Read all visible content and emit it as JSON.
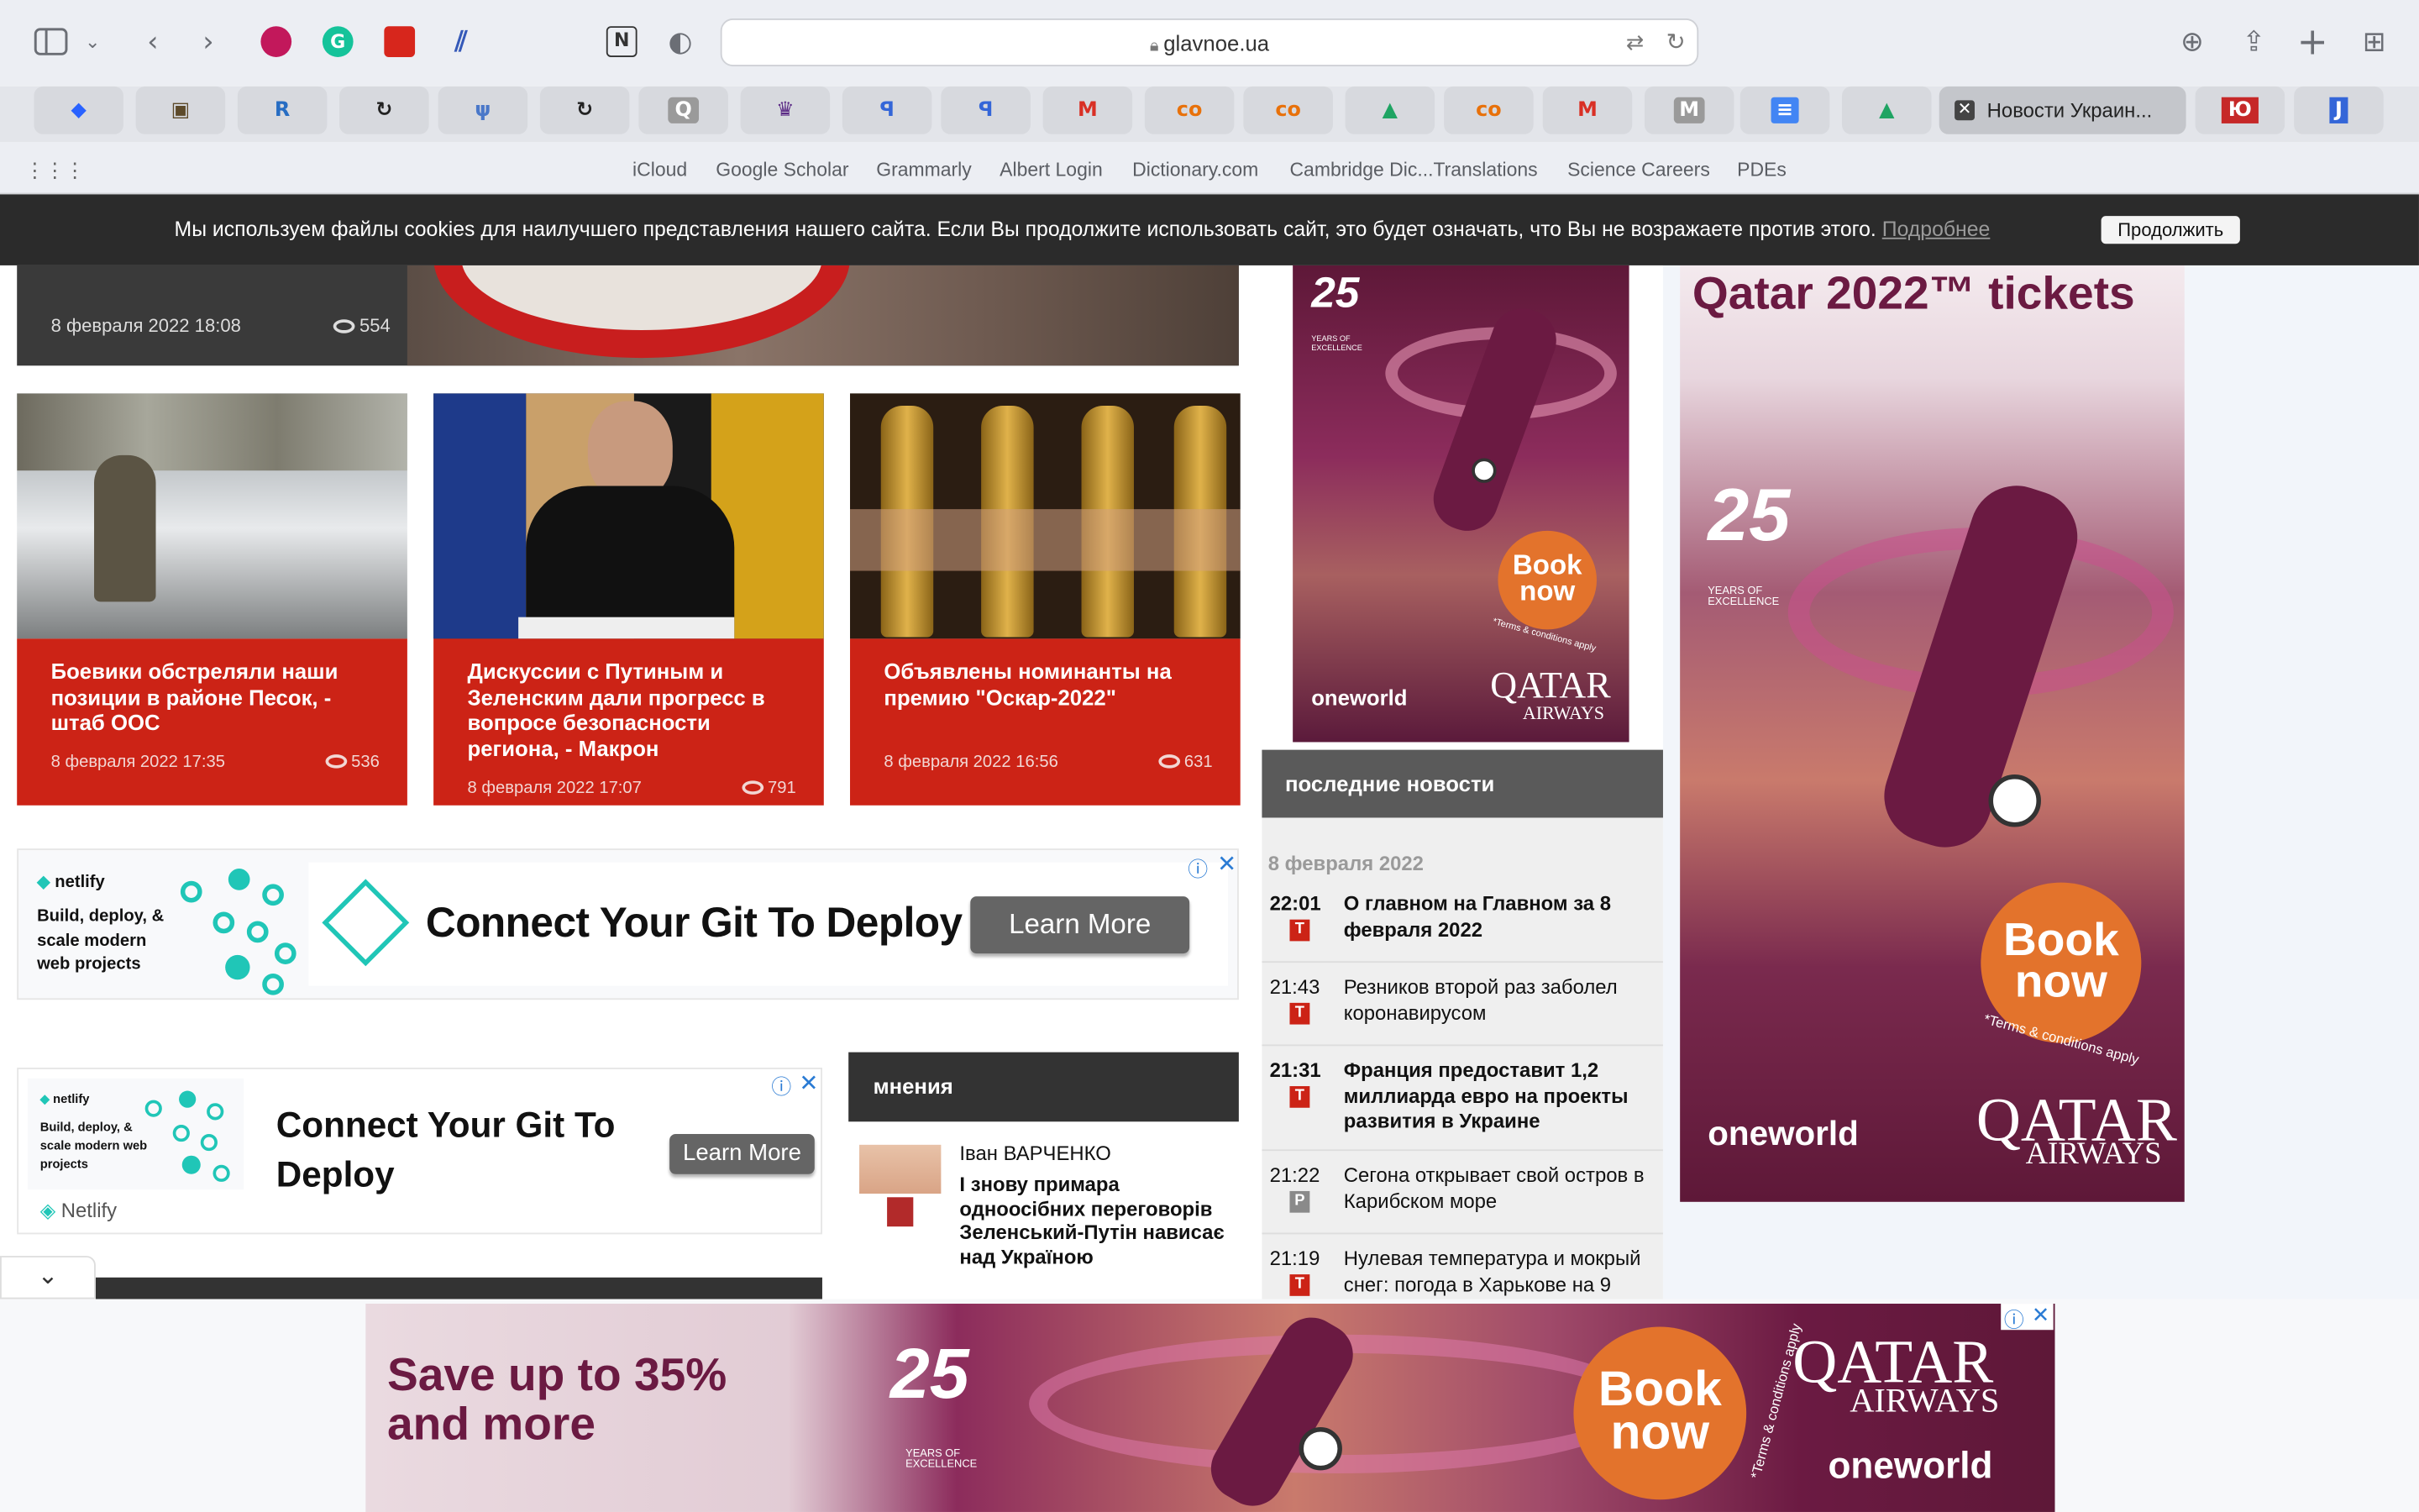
{
  "browser": {
    "url": "glavnoe.ua",
    "active_tab_title": "Новости Украин...",
    "favorites": [
      "iCloud",
      "Google Scholar",
      "Grammarly",
      "Albert Login",
      "Dictionary.com",
      "Cambridge Dic...Translations",
      "Science Careers",
      "PDEs"
    ],
    "tab_icons": [
      "R",
      "Q",
      "ꟼ",
      "ꟼ",
      "M",
      "co",
      "co",
      "co",
      "M",
      "M",
      "≡",
      "Ю",
      "J"
    ]
  },
  "cookie": {
    "text": "Мы используем файлы cookies для наилучшего представления нашего сайта. Если Вы продолжите использовать сайт, это будет означать, что Вы не возражаете против этого.",
    "link": "Подробнее",
    "button": "Продолжить"
  },
  "top_article": {
    "date": "8 февраля 2022 18:08",
    "views": "554"
  },
  "cards": [
    {
      "title": "Боевики обстреляли наши позиции в районе Песок, - штаб ООС",
      "date": "8 февраля 2022 17:35",
      "views": "536"
    },
    {
      "title": "Дискуссии с Путиным и Зеленским дали прогресс в вопросе безопасности региона, - Макрон",
      "date": "8 февраля 2022 17:07",
      "views": "791"
    },
    {
      "title": "Объявлены номинанты на премию \"Оскар-2022\"",
      "date": "8 февраля 2022 16:56",
      "views": "631"
    }
  ],
  "netlify_ad_1": {
    "brand": "netlify",
    "tagline": "Build, deploy, & scale modern web projects",
    "headline": "Connect Your Git To Deploy",
    "button": "Learn More"
  },
  "netlify_ad_2": {
    "brand": "netlify",
    "tagline": "Build, deploy, & scale modern web projects",
    "headline": "Connect Your Git To Deploy",
    "button": "Learn More",
    "footer": "Netlify"
  },
  "opinions": {
    "header": "мнения",
    "author": "Іван ВАРЧЕНКО",
    "title": "І знову примара одноосібних переговорів Зеленський-Путін нависає над Україною"
  },
  "latest_news": {
    "header": "последние новости",
    "date": "8 февраля 2022",
    "items": [
      {
        "time": "22:01",
        "title": "О главном на Главном за 8 февраля 2022",
        "bold": true,
        "badge": "T",
        "color": "#cc2316"
      },
      {
        "time": "21:43",
        "title": "Резников второй раз заболел коронавирусом",
        "bold": false,
        "badge": "T",
        "color": "#cc2316"
      },
      {
        "time": "21:31",
        "title": "Франция предоставит 1,2 миллиарда евро на проекты развития в Украине",
        "bold": true,
        "badge": "T",
        "color": "#cc2316"
      },
      {
        "time": "21:22",
        "title": "Сегона открывает свой остров в Карибском море",
        "bold": false,
        "badge": "P",
        "color": "#8a8a8a"
      },
      {
        "time": "21:19",
        "title": "Нулевая температура и мокрый снег: погода в Харькове на 9",
        "bold": false,
        "badge": "T",
        "color": "#cc2316"
      }
    ]
  },
  "qatar_ad_small": {
    "book": "Book now",
    "terms": "*Terms & conditions apply",
    "oneworld": "oneworld",
    "brand": "QATAR",
    "brand2": "AIRWAYS",
    "years": "25",
    "years_sub": "YEARS OF EXCELLENCE"
  },
  "qatar_ad_large": {
    "headline": "Qatar 2022™ tickets",
    "book": "Book now",
    "terms": "*Terms & conditions apply",
    "oneworld": "oneworld",
    "brand": "QATAR",
    "brand2": "AIRWAYS",
    "years": "25",
    "years_sub": "YEARS OF EXCELLENCE"
  },
  "qatar_ad_bottom": {
    "headline1": "Save up to 35%",
    "headline2": "and more",
    "book": "Book now",
    "terms": "*Terms & conditions apply",
    "oneworld": "oneworld",
    "brand": "QATAR",
    "brand2": "AIRWAYS",
    "years": "25",
    "years_sub": "YEARS OF EXCELLENCE"
  },
  "colors": {
    "accent_red": "#cc2316",
    "dark_header": "#5a5a5a",
    "qatar_maroon": "#6b1a42",
    "book_orange": "#e3732c"
  }
}
